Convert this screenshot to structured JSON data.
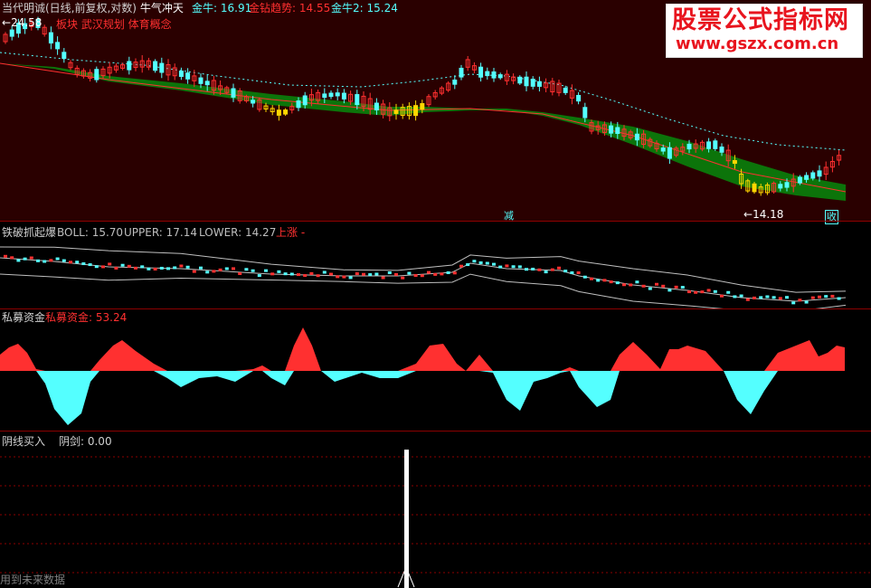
{
  "colors": {
    "bg": "#000000",
    "main_bg": "#2a0000",
    "up": "#ff3030",
    "down": "#54ffff",
    "yellow": "#ffd700",
    "band": "#0b7a0b",
    "divider": "#8b0000",
    "white": "#ffffff"
  },
  "pane1": {
    "header": {
      "name": "当代明诚(日线,前复权,对数)",
      "indicator": "牛气冲天",
      "g1_label": "金牛: 16.91",
      "g2_label": "金钻趋势: 14.55",
      "g3_label": "金牛2: 15.24"
    },
    "concepts": "武汉规划  体育概念",
    "concept_prefix": "板块",
    "high_label": "24.58",
    "low_label": "14.18",
    "marker_jian": "减",
    "marker_shou": "收",
    "watermark_title": "股票公式指标网",
    "watermark_url": "www.gszx.com.cn"
  },
  "pane2": {
    "name": "铁破抓起爆",
    "boll": "BOLL: 15.70",
    "upper": "UPPER: 17.14",
    "lower": "LOWER: 14.27",
    "signal": "上涨 -"
  },
  "pane3": {
    "name": "私募资金",
    "value_label": "私募资金: 53.24"
  },
  "pane4": {
    "name": "阴线买入",
    "value_label": "阴剑: 0.00",
    "footnote": "用到未来数据"
  }
}
